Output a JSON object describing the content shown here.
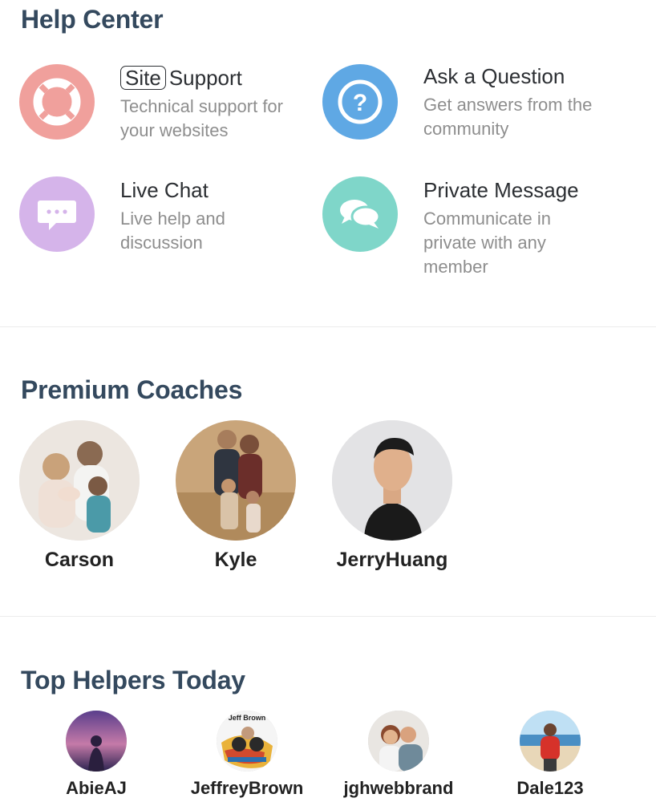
{
  "help_center": {
    "title": "Help Center",
    "items": [
      {
        "badge": "Site",
        "title": "Support",
        "desc": "Technical support for your websites",
        "icon": "lifebuoy-icon",
        "color": "#f0a09c"
      },
      {
        "title": "Ask a Question",
        "desc": "Get answers from the community",
        "icon": "question-icon",
        "color": "#5fa8e4"
      },
      {
        "title": "Live Chat",
        "desc": "Live help and discussion",
        "icon": "chat-bubble-icon",
        "color": "#d5b4ea"
      },
      {
        "title": "Private Message",
        "desc": "Communicate in private with any member",
        "icon": "messages-icon",
        "color": "#7fd6c9"
      }
    ]
  },
  "premium_coaches": {
    "title": "Premium Coaches",
    "coaches": [
      {
        "name": "Carson"
      },
      {
        "name": "Kyle"
      },
      {
        "name": "JerryHuang"
      }
    ]
  },
  "top_helpers": {
    "title": "Top Helpers Today",
    "helpers": [
      {
        "name": "AbieAJ"
      },
      {
        "name": "JeffreyBrown",
        "avatar_text": "Jeff Brown"
      },
      {
        "name": "jghwebbrand"
      },
      {
        "name": "Dale123"
      }
    ]
  }
}
